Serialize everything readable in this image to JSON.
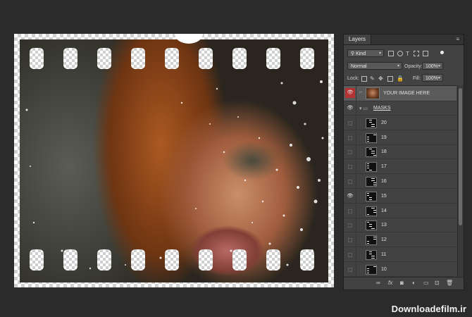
{
  "panel": {
    "tab_label": "Layers",
    "filter": {
      "kind_label": "Kind"
    },
    "blend_mode": "Normal",
    "opacity_label": "Opacity:",
    "opacity_value": "100%",
    "lock_label": "Lock:",
    "fill_label": "Fill:",
    "fill_value": "100%"
  },
  "layers": [
    {
      "name": "YOUR IMAGE HERE",
      "type": "image",
      "visible": true,
      "selected": true
    },
    {
      "name": "MASKS",
      "type": "group",
      "visible": true,
      "expanded": true
    },
    {
      "name": "20",
      "type": "mask",
      "visible": false
    },
    {
      "name": "19",
      "type": "mask",
      "visible": false
    },
    {
      "name": "18",
      "type": "mask",
      "visible": false
    },
    {
      "name": "17",
      "type": "mask",
      "visible": false
    },
    {
      "name": "16",
      "type": "mask",
      "visible": false
    },
    {
      "name": "15",
      "type": "mask",
      "visible": true
    },
    {
      "name": "14",
      "type": "mask",
      "visible": false
    },
    {
      "name": "13",
      "type": "mask",
      "visible": false
    },
    {
      "name": "12",
      "type": "mask",
      "visible": false
    },
    {
      "name": "11",
      "type": "mask",
      "visible": false
    },
    {
      "name": "10",
      "type": "mask",
      "visible": false
    }
  ],
  "footer_icons": [
    "link-icon",
    "fx-icon",
    "add-mask-icon",
    "adjustment-icon",
    "new-group-icon",
    "new-layer-icon",
    "trash-icon"
  ],
  "watermark": "Downloadefilm.ir",
  "colors": {
    "background": "#2b2b2b",
    "panel": "#424242",
    "selected_eye": "#b43232"
  }
}
